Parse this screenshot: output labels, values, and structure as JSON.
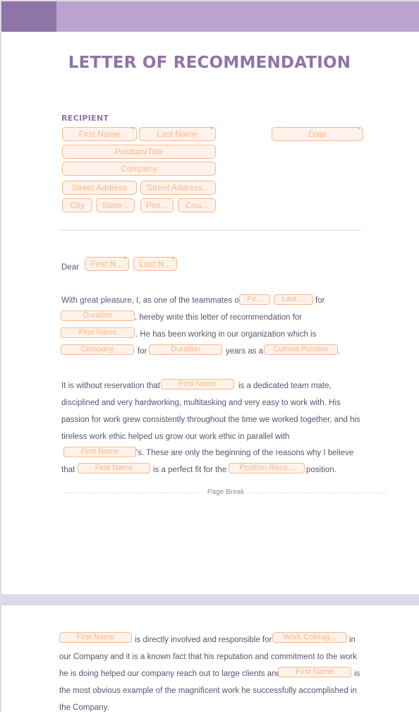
{
  "document": {
    "title": "LETTER OF RECOMMENDATION",
    "colors": {
      "header_band": "#bca3cf",
      "header_accent": "#8f74a6",
      "title": "#8f74a6",
      "field_border": "#f5b98e",
      "field_fill": "#fff2ea",
      "required": "#e5483c",
      "body_text": "#5a5470"
    }
  },
  "recipient": {
    "label": "RECIPIENT",
    "first_name": "First Name",
    "last_name": "Last Name",
    "date": "Date",
    "position_title": "Position/Title",
    "company": "Company",
    "street_address": "Street Address",
    "street_address_2": "Street Address...",
    "city": "City",
    "state": "State...",
    "postal": "Pos...",
    "country": "Cou...",
    "required_mark": "*"
  },
  "salutation": {
    "dear": "Dear",
    "first_name": "First N...",
    "last_name": "Last N..."
  },
  "para1": {
    "t1": "With great pleasure, I, as one of the teammates of",
    "f_first": "Fir...",
    "f_last": "Last ...",
    "t2": "for",
    "f_duration": "Duration",
    "t3": ", hereby write this letter of recommendation for",
    "f_first_name": "First Name",
    "t4": ". He has been working in our organization which is",
    "f_company": "Company",
    "t5": "for",
    "f_duration2": "Duration",
    "t6": "years as a",
    "f_position": "Current Position",
    "t7": "."
  },
  "para2": {
    "t1": "It is without reservation that",
    "f1": "First Name",
    "t2": "is a dedicated team mate,",
    "l2": "disciplined and very hardworking, multitasking and very easy to work with. His",
    "l3": "passion for work grew consistently throughout the time we worked together, and his",
    "l4": "tireless work ethic helped us grow our work ethic in parallel with",
    "f2": "First Name",
    "t3": "'s. These are only the beginning of the reasons why I believe",
    "t4": "that",
    "f3": "First Name",
    "t5": "is a perfect fit for the",
    "f4": "Position Reco...",
    "t6": "position."
  },
  "page_break": {
    "label": "Page Break"
  },
  "para3": {
    "f1": "First Name",
    "t1": "is directly involved and responsible for",
    "f2": "Work Colleag...",
    "t2": "in",
    "l2": "our Company and it is a known fact that his reputation and commitment to the work",
    "l3a": "he is doing helped our company reach out to large clients and",
    "f3": "First Name",
    "t3": "is",
    "l4": "the most obvious example of the magnificent work he successfully accomplished in",
    "l5": "the Company."
  }
}
